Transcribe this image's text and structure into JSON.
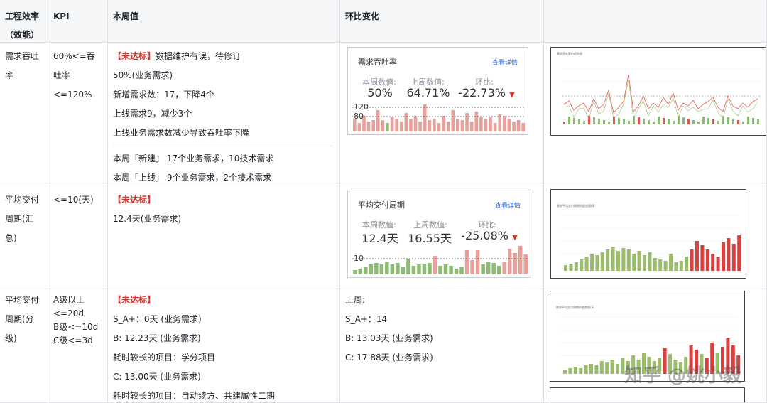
{
  "header": {
    "col1": "工程效率（效能）",
    "col2": "KPI",
    "col3": "本周值",
    "col4": "环比变化"
  },
  "rows": [
    {
      "metric": "需求吞吐率",
      "kpi": "60%<=吞吐率<=120%",
      "status": "【未达标】",
      "status_note": "数据维护有误，待修订",
      "lines": [
        "50%(业务需求)",
        "新增需求数：17，下降4个",
        "上线需求9，减少3个",
        "上线业务需求数减少导致吞吐率下降"
      ],
      "lines2": [
        "本周「新建」 17个业务需求，10技术需求",
        "本周「上线」 9个业务需求，2个技术需求"
      ],
      "card": {
        "title": "需求吞吐率",
        "link": "查看详情",
        "labels": [
          "本周数值:",
          "上周数值:",
          "环比:"
        ],
        "values": [
          "50%",
          "64.71%",
          "-22.73%"
        ],
        "ref_lines": [
          "120",
          "80"
        ]
      },
      "thumb_title": "需求吞吐率的趋势图"
    },
    {
      "metric": "平均交付周期(汇总)",
      "kpi": "<=10(天)",
      "status": "【未达标】",
      "lines": [
        "12.4天(业务需求)"
      ],
      "card": {
        "title": "平均交付周期",
        "link": "查看详情",
        "labels": [
          "本周数值:",
          "上周数值:",
          "环比:"
        ],
        "values": [
          "12.4天",
          "16.55天",
          "-25.08%"
        ],
        "ref_lines": [
          "10"
        ]
      },
      "thumb_title": "需求平均交付周期的趋势图/天"
    },
    {
      "metric": "平均交付周期(分级)",
      "kpi_lines": [
        "A级以上",
        "<=20d",
        "B级<=10d",
        "C级<=3d"
      ],
      "status": "【未达标】",
      "lines": [
        "S_A+：0天 (业务需求)",
        "B: 12.23天 (业务需求)",
        "耗时较长的项目：学分项目",
        "C: 13.00天 (业务需求)",
        "耗时较长的项目：自动续方、共建属性二期"
      ],
      "prev": [
        "上周:",
        "S_A+：14",
        "B: 13.03天 (业务需求)",
        "C: 17.88天 (业务需求)"
      ],
      "thumb_title": "需求平均交付周期的趋势图/天"
    }
  ],
  "watermark": "知乎 @姚小毅",
  "colors": {
    "red": "#e02e24",
    "bar_red": "#e9a09a",
    "bar_green": "#8dbb74",
    "link": "#3370ff"
  }
}
